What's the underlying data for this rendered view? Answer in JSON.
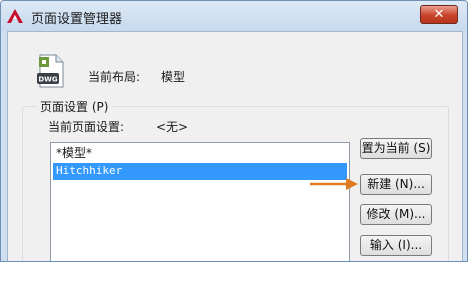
{
  "window": {
    "title": "页面设置管理器",
    "close_label": "✕"
  },
  "info": {
    "icon_caption": "DWG",
    "current_layout_label": "当前布局:",
    "current_layout_value": "模型"
  },
  "page_setup": {
    "group_title": "页面设置 (P)",
    "current_setup_label": "当前页面设置:",
    "current_setup_value": "<无>",
    "list": [
      {
        "label": "*模型*",
        "selected": false
      },
      {
        "label": "Hitchhiker",
        "selected": true
      }
    ]
  },
  "buttons": {
    "set_current": "置为当前 (S)",
    "new": "新建 (N)...",
    "modify": "修改 (M)...",
    "import": "输入 (I)..."
  },
  "colors": {
    "selection": "#3399ff",
    "arrow": "#e07b22",
    "close_button": "#c7432b"
  }
}
